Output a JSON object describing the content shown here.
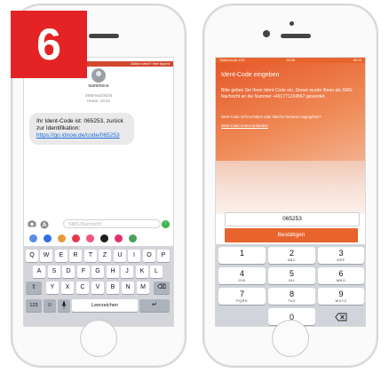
{
  "badge": {
    "step": "6"
  },
  "left_phone": {
    "banner": "Aktive Ident? Hier tippen",
    "contact_label": "wartenece",
    "sms_label": "SMS-Nachricht",
    "sms_time": "Heute, 10:34",
    "message_prefix": "Ihr Ident-Code ist: 065253, zurück zur Identifikation: ",
    "message_link": "https://go.idnow.de/code/065253",
    "input_placeholder": "SMS-Nachricht",
    "keyboard": {
      "row1": [
        "Q",
        "W",
        "E",
        "R",
        "T",
        "Z",
        "U",
        "I",
        "O",
        "P"
      ],
      "row2": [
        "A",
        "S",
        "D",
        "F",
        "G",
        "H",
        "J",
        "K",
        "L"
      ],
      "row3": [
        "Y",
        "X",
        "C",
        "V",
        "B",
        "N",
        "M"
      ],
      "shift_icon": "shift-icon",
      "delete_icon": "delete-icon",
      "numbers_key": "123",
      "emoji_icon": "emoji-icon",
      "mic_icon": "mic-icon",
      "space_key": "Leerzeichen",
      "return_icon": "return-icon"
    }
  },
  "right_phone": {
    "carrier": "Telekom.de LTE",
    "time": "10:35",
    "battery": "69 %",
    "title": "Ident-Code eingeben",
    "body": "Bitte geben Sie Ihren Ident-Code ein. Dieser wurde Ihnen als SMS-Nachricht an die Nummer +491771234567 gesendet.",
    "hint": "Ident-Code nicht erhalten oder falsche Nummer angegeben?",
    "resend_link": "Ident-Code erneut anfordern",
    "code_value": "065253",
    "confirm_label": "Bestätigen",
    "numpad": [
      {
        "d": "1",
        "s": ""
      },
      {
        "d": "2",
        "s": "ABC"
      },
      {
        "d": "3",
        "s": "DEF"
      },
      {
        "d": "4",
        "s": "GHI"
      },
      {
        "d": "5",
        "s": "JKL"
      },
      {
        "d": "6",
        "s": "MNO"
      },
      {
        "d": "7",
        "s": "PQRS"
      },
      {
        "d": "8",
        "s": "TUV"
      },
      {
        "d": "9",
        "s": "WXYZ"
      },
      {
        "d": "0",
        "s": ""
      }
    ],
    "delete_icon": "backspace-icon"
  },
  "colors": {
    "badge_red": "#e42424",
    "brand_orange": "#e8642c",
    "sms_link": "#1a6cd8",
    "send_green": "#3fb34f"
  }
}
